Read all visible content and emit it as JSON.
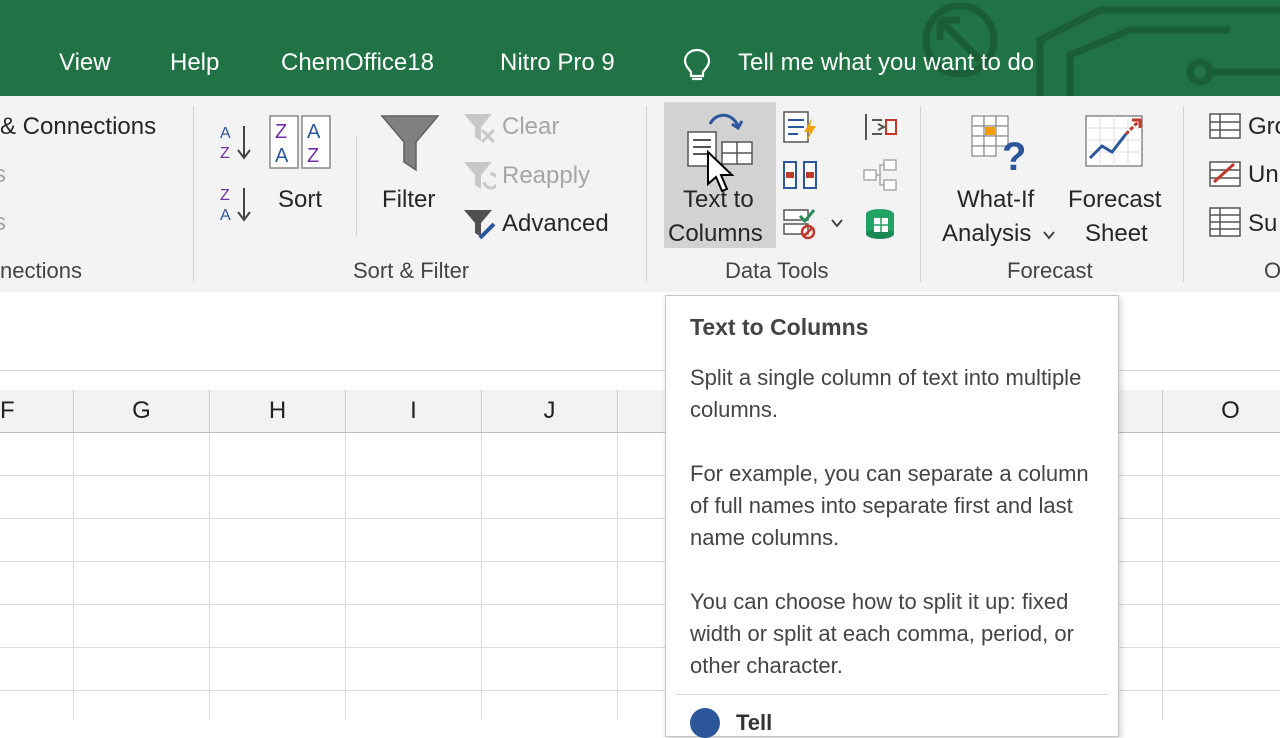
{
  "tabs": [
    "View",
    "Help",
    "ChemOffice18",
    "Nitro Pro 9"
  ],
  "tell_me": "Tell me what you want to do",
  "connections": {
    "label": "& Connections",
    "group_label": "nections"
  },
  "sort_filter": {
    "sort_label": "Sort",
    "filter_label": "Filter",
    "clear_label": "Clear",
    "reapply_label": "Reapply",
    "advanced_label": "Advanced",
    "group_label": "Sort & Filter"
  },
  "data_tools": {
    "text_to_columns_line1": "Text to",
    "text_to_columns_line2": "Columns",
    "group_label": "Data Tools"
  },
  "forecast": {
    "what_if_line1": "What-If",
    "what_if_line2": "Analysis",
    "forecast_sheet_line1": "Forecast",
    "forecast_sheet_line2": "Sheet",
    "group_label": "Forecast"
  },
  "outline": {
    "group_partial": "Gro",
    "ungroup_partial": "Un",
    "subtotal_partial": "Su",
    "group_label_partial": "O"
  },
  "columns": [
    "F",
    "G",
    "H",
    "I",
    "J",
    "O"
  ],
  "tooltip": {
    "title": "Text to Columns",
    "p1": "Split a single column of text into multiple columns.",
    "p2": "For example, you can separate a column of full names into separate first and last name columns.",
    "p3": "You can choose how to split it up: fixed width or split at each comma, period, or other character.",
    "help": "Tell"
  },
  "colors": {
    "excel_green": "#217346",
    "ribbon_bg": "#f3f3f3",
    "accent_blue": "#2b579a",
    "accent_red": "#c0392b"
  }
}
